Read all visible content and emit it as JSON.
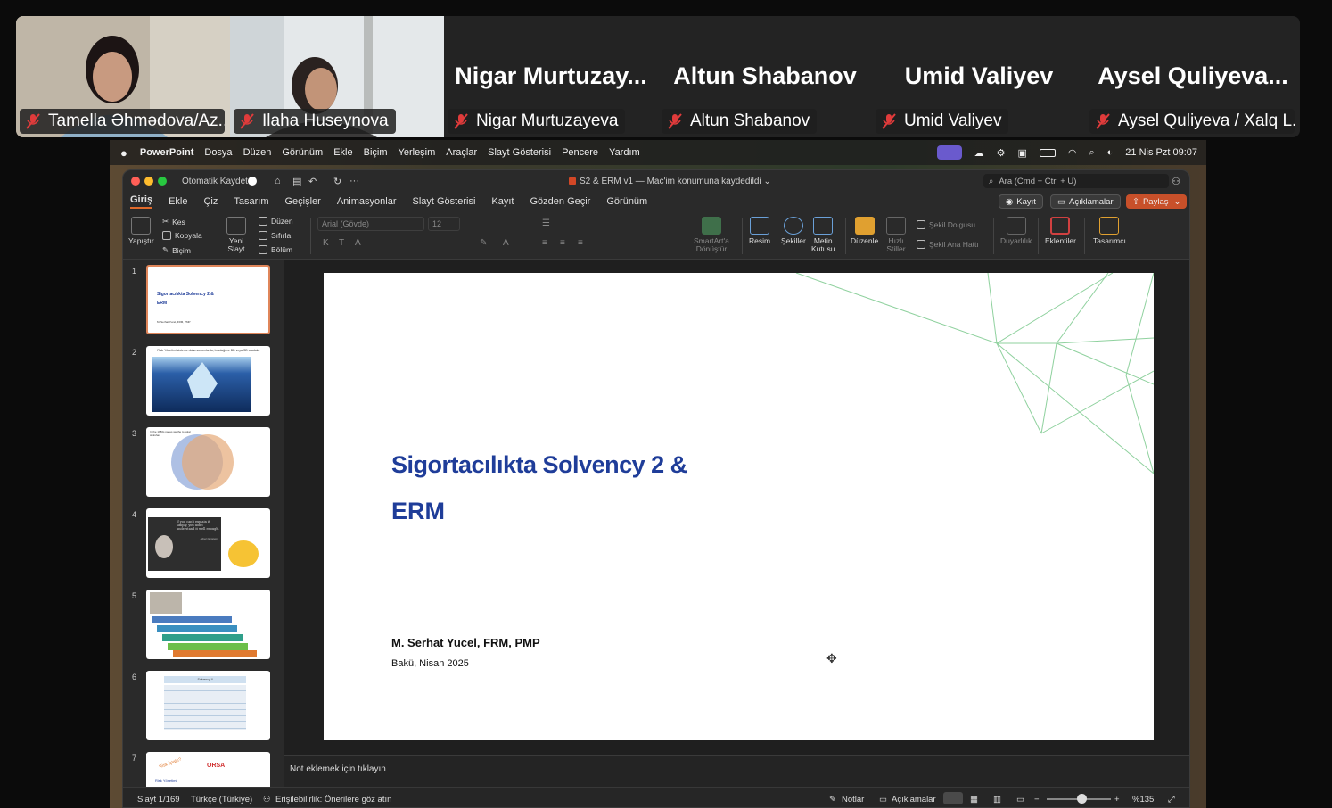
{
  "participants": [
    {
      "name": "Tamella Əhmədova/Az...",
      "muted": true,
      "video": true
    },
    {
      "name": "Ilaha Huseynova",
      "muted": true,
      "video": true
    },
    {
      "name": "Nigar Murtuzayeva",
      "display": "Nigar  Murtuzay...",
      "muted": true,
      "video": false
    },
    {
      "name": "Altun Shabanov",
      "display": "Altun Shabanov",
      "muted": true,
      "video": false
    },
    {
      "name": "Umid Valiyev",
      "display": "Umid Valiyev",
      "muted": true,
      "video": false
    },
    {
      "name": "Aysel Quliyeva / Xalq L...",
      "display": "Aysel  Quliyeva...",
      "muted": true,
      "video": false
    }
  ],
  "menubar": {
    "app": "PowerPoint",
    "items": [
      "Dosya",
      "Düzen",
      "Görünüm",
      "Ekle",
      "Biçim",
      "Yerleşim",
      "Araçlar",
      "Slayt Gösterisi",
      "Pencere",
      "Yardım"
    ],
    "datetime": "21 Nis Pzt  09:07"
  },
  "window": {
    "autosave": "Otomatik Kaydet",
    "title": "S2 & ERM v1 — Mac'im konumuna kaydedildi ⌄",
    "search_placeholder": "Ara (Cmd + Ctrl + U)"
  },
  "tabs": [
    "Giriş",
    "Ekle",
    "Çiz",
    "Tasarım",
    "Geçişler",
    "Animasyonlar",
    "Slayt Gösterisi",
    "Kayıt",
    "Gözden Geçir",
    "Görünüm"
  ],
  "actions": {
    "record": "Kayıt",
    "comments": "Açıklamalar",
    "share": "Paylaş"
  },
  "ribbon": {
    "paste": "Yapıştır",
    "cut": "Kes",
    "copy": "Kopyala",
    "format": "Biçim",
    "new_slide": "Yeni\nSlayt",
    "layout": "Düzen",
    "reset": "Sıfırla",
    "section": "Bölüm",
    "font_name": "Arial (Gövde)",
    "font_size": "12",
    "smartart": "SmartArt'a\nDönüştür",
    "picture": "Resim",
    "shapes": "Şekiller",
    "textbox": "Metin\nKutusu",
    "arrange": "Düzenle",
    "quick_styles": "Hızlı\nStiller",
    "shape_fill": "Şekil Dolgusu",
    "shape_outline": "Şekil Ana Hattı",
    "sensitivity": "Duyarlılık",
    "addins": "Eklentiler",
    "designer": "Tasarımcı"
  },
  "thumbnails": [
    {
      "n": "1",
      "title": "Sigortacılıkta Solvency 2 &",
      "title2": "ERM",
      "sub": "M. Serhat Yucel, FRM, PMP"
    },
    {
      "n": "2",
      "title": "Risk Yönetimi sisteme daha sunumlarda, buzdağı ve BD veya SD aradalar"
    },
    {
      "n": "3",
      "title": "In the 1980s pages we the to solar sinkshan"
    },
    {
      "n": "4",
      "title": "If you can't explain it simply, you don't understand it well enough.",
      "author": "Albert Einstein"
    },
    {
      "n": "5"
    },
    {
      "n": "6",
      "title": "Solvency II"
    },
    {
      "n": "7",
      "w1": "Risk İştahı?",
      "w2": "ORSA",
      "w3": "Risk Yönetimi"
    }
  ],
  "slide": {
    "title_line1": "Sigortacılıkta Solvency 2 &",
    "title_line2": "ERM",
    "author": "M. Serhat Yucel, FRM, PMP",
    "place_date": "Bakü, Nisan 2025"
  },
  "notes_placeholder": "Not eklemek için tıklayın",
  "status": {
    "slide": "Slayt 1/169",
    "language": "Türkçe (Türkiye)",
    "accessibility": "Erişilebilirlik: Önerilere göz atın",
    "notes": "Notlar",
    "comments": "Açıklamalar",
    "zoom": "%135"
  },
  "colors": {
    "accent": "#e06a2b",
    "title_blue": "#1f3d99",
    "green_lines": "#8fd19e",
    "share": "#c8502a"
  }
}
